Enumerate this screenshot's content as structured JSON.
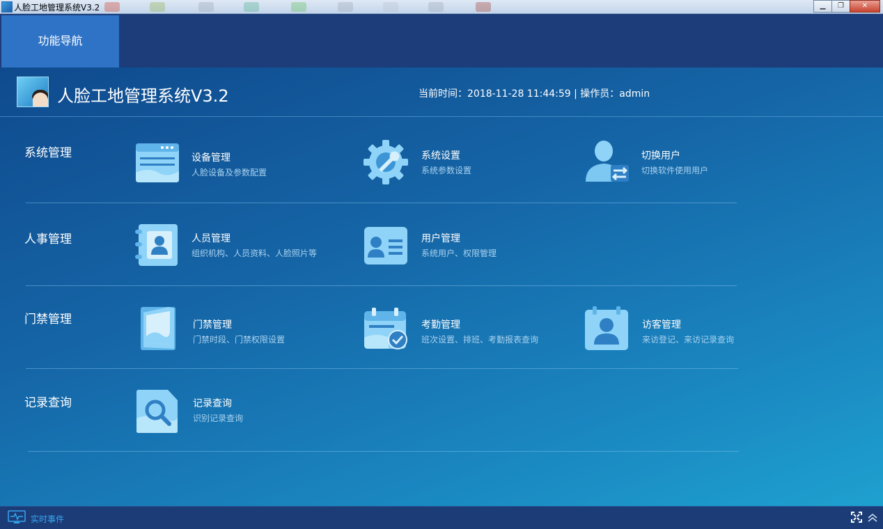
{
  "window": {
    "title": "人脸工地管理系统V3.2",
    "minimize_icon": "minimize-icon",
    "restore_icon": "restore-icon",
    "close_icon": "close-icon"
  },
  "nav": {
    "tabs": [
      {
        "label": "功能导航",
        "active": true
      }
    ]
  },
  "header": {
    "app_title": "人脸工地管理系统V3.2",
    "status": "当前时间：2018-11-28 11:44:59 | 操作员：admin"
  },
  "sections": [
    {
      "title": "系统管理",
      "items": [
        {
          "title": "设备管理",
          "desc": "人脸设备及参数配置",
          "icon": "device-icon"
        },
        {
          "title": "系统设置",
          "desc": "系统参数设置",
          "icon": "gear-wrench-icon"
        },
        {
          "title": "切换用户",
          "desc": "切换软件使用用户",
          "icon": "switch-user-icon"
        }
      ]
    },
    {
      "title": "人事管理",
      "items": [
        {
          "title": "人员管理",
          "desc": "组织机构、人员资料、人脸照片等",
          "icon": "contact-book-icon"
        },
        {
          "title": "用户管理",
          "desc": "系统用户、权限管理",
          "icon": "id-card-icon"
        }
      ]
    },
    {
      "title": "门禁管理",
      "items": [
        {
          "title": "门禁管理",
          "desc": "门禁时段、门禁权限设置",
          "icon": "door-icon"
        },
        {
          "title": "考勤管理",
          "desc": "班次设置、排班、考勤报表查询",
          "icon": "calendar-check-icon"
        },
        {
          "title": "访客管理",
          "desc": "来访登记、来访记录查询",
          "icon": "visitor-icon"
        }
      ]
    },
    {
      "title": "记录查询",
      "items": [
        {
          "title": "记录查询",
          "desc": "识别记录查询",
          "icon": "search-doc-icon"
        }
      ]
    }
  ],
  "statusbar": {
    "event_label": "实时事件",
    "event_icon": "monitor-pulse-icon",
    "fullscreen_icon": "fullscreen-icon",
    "collapse_icon": "chevron-up-icon"
  },
  "colors": {
    "nav_bg": "#1c3d7a",
    "nav_active": "#2e73c6",
    "accent": "#38a6ef",
    "icon_light": "#8fd4f8"
  }
}
